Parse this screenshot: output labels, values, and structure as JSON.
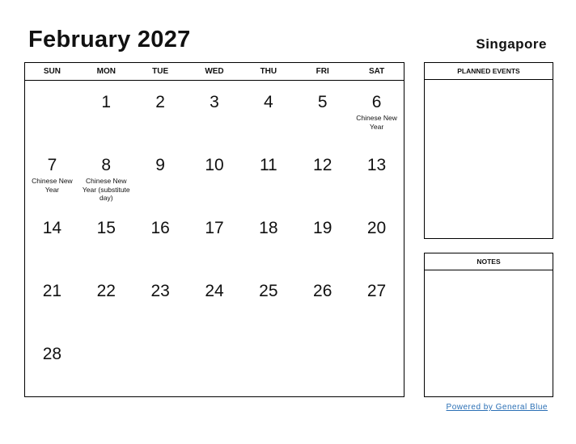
{
  "header": {
    "title": "February 2027",
    "country": "Singapore"
  },
  "weekdays": [
    "SUN",
    "MON",
    "TUE",
    "WED",
    "THU",
    "FRI",
    "SAT"
  ],
  "weeks": [
    [
      {
        "d": "",
        "e": ""
      },
      {
        "d": "1",
        "e": ""
      },
      {
        "d": "2",
        "e": ""
      },
      {
        "d": "3",
        "e": ""
      },
      {
        "d": "4",
        "e": ""
      },
      {
        "d": "5",
        "e": ""
      },
      {
        "d": "6",
        "e": "Chinese New Year"
      }
    ],
    [
      {
        "d": "7",
        "e": "Chinese New Year"
      },
      {
        "d": "8",
        "e": "Chinese New Year (substitute day)"
      },
      {
        "d": "9",
        "e": ""
      },
      {
        "d": "10",
        "e": ""
      },
      {
        "d": "11",
        "e": ""
      },
      {
        "d": "12",
        "e": ""
      },
      {
        "d": "13",
        "e": ""
      }
    ],
    [
      {
        "d": "14",
        "e": ""
      },
      {
        "d": "15",
        "e": ""
      },
      {
        "d": "16",
        "e": ""
      },
      {
        "d": "17",
        "e": ""
      },
      {
        "d": "18",
        "e": ""
      },
      {
        "d": "19",
        "e": ""
      },
      {
        "d": "20",
        "e": ""
      }
    ],
    [
      {
        "d": "21",
        "e": ""
      },
      {
        "d": "22",
        "e": ""
      },
      {
        "d": "23",
        "e": ""
      },
      {
        "d": "24",
        "e": ""
      },
      {
        "d": "25",
        "e": ""
      },
      {
        "d": "26",
        "e": ""
      },
      {
        "d": "27",
        "e": ""
      }
    ],
    [
      {
        "d": "28",
        "e": ""
      },
      {
        "d": "",
        "e": ""
      },
      {
        "d": "",
        "e": ""
      },
      {
        "d": "",
        "e": ""
      },
      {
        "d": "",
        "e": ""
      },
      {
        "d": "",
        "e": ""
      },
      {
        "d": "",
        "e": ""
      }
    ]
  ],
  "side": {
    "planned_events": "PLANNED EVENTS",
    "notes": "NOTES"
  },
  "footer": {
    "powered_by": "Powered by General Blue",
    "link_color": "#2a6fb5"
  }
}
